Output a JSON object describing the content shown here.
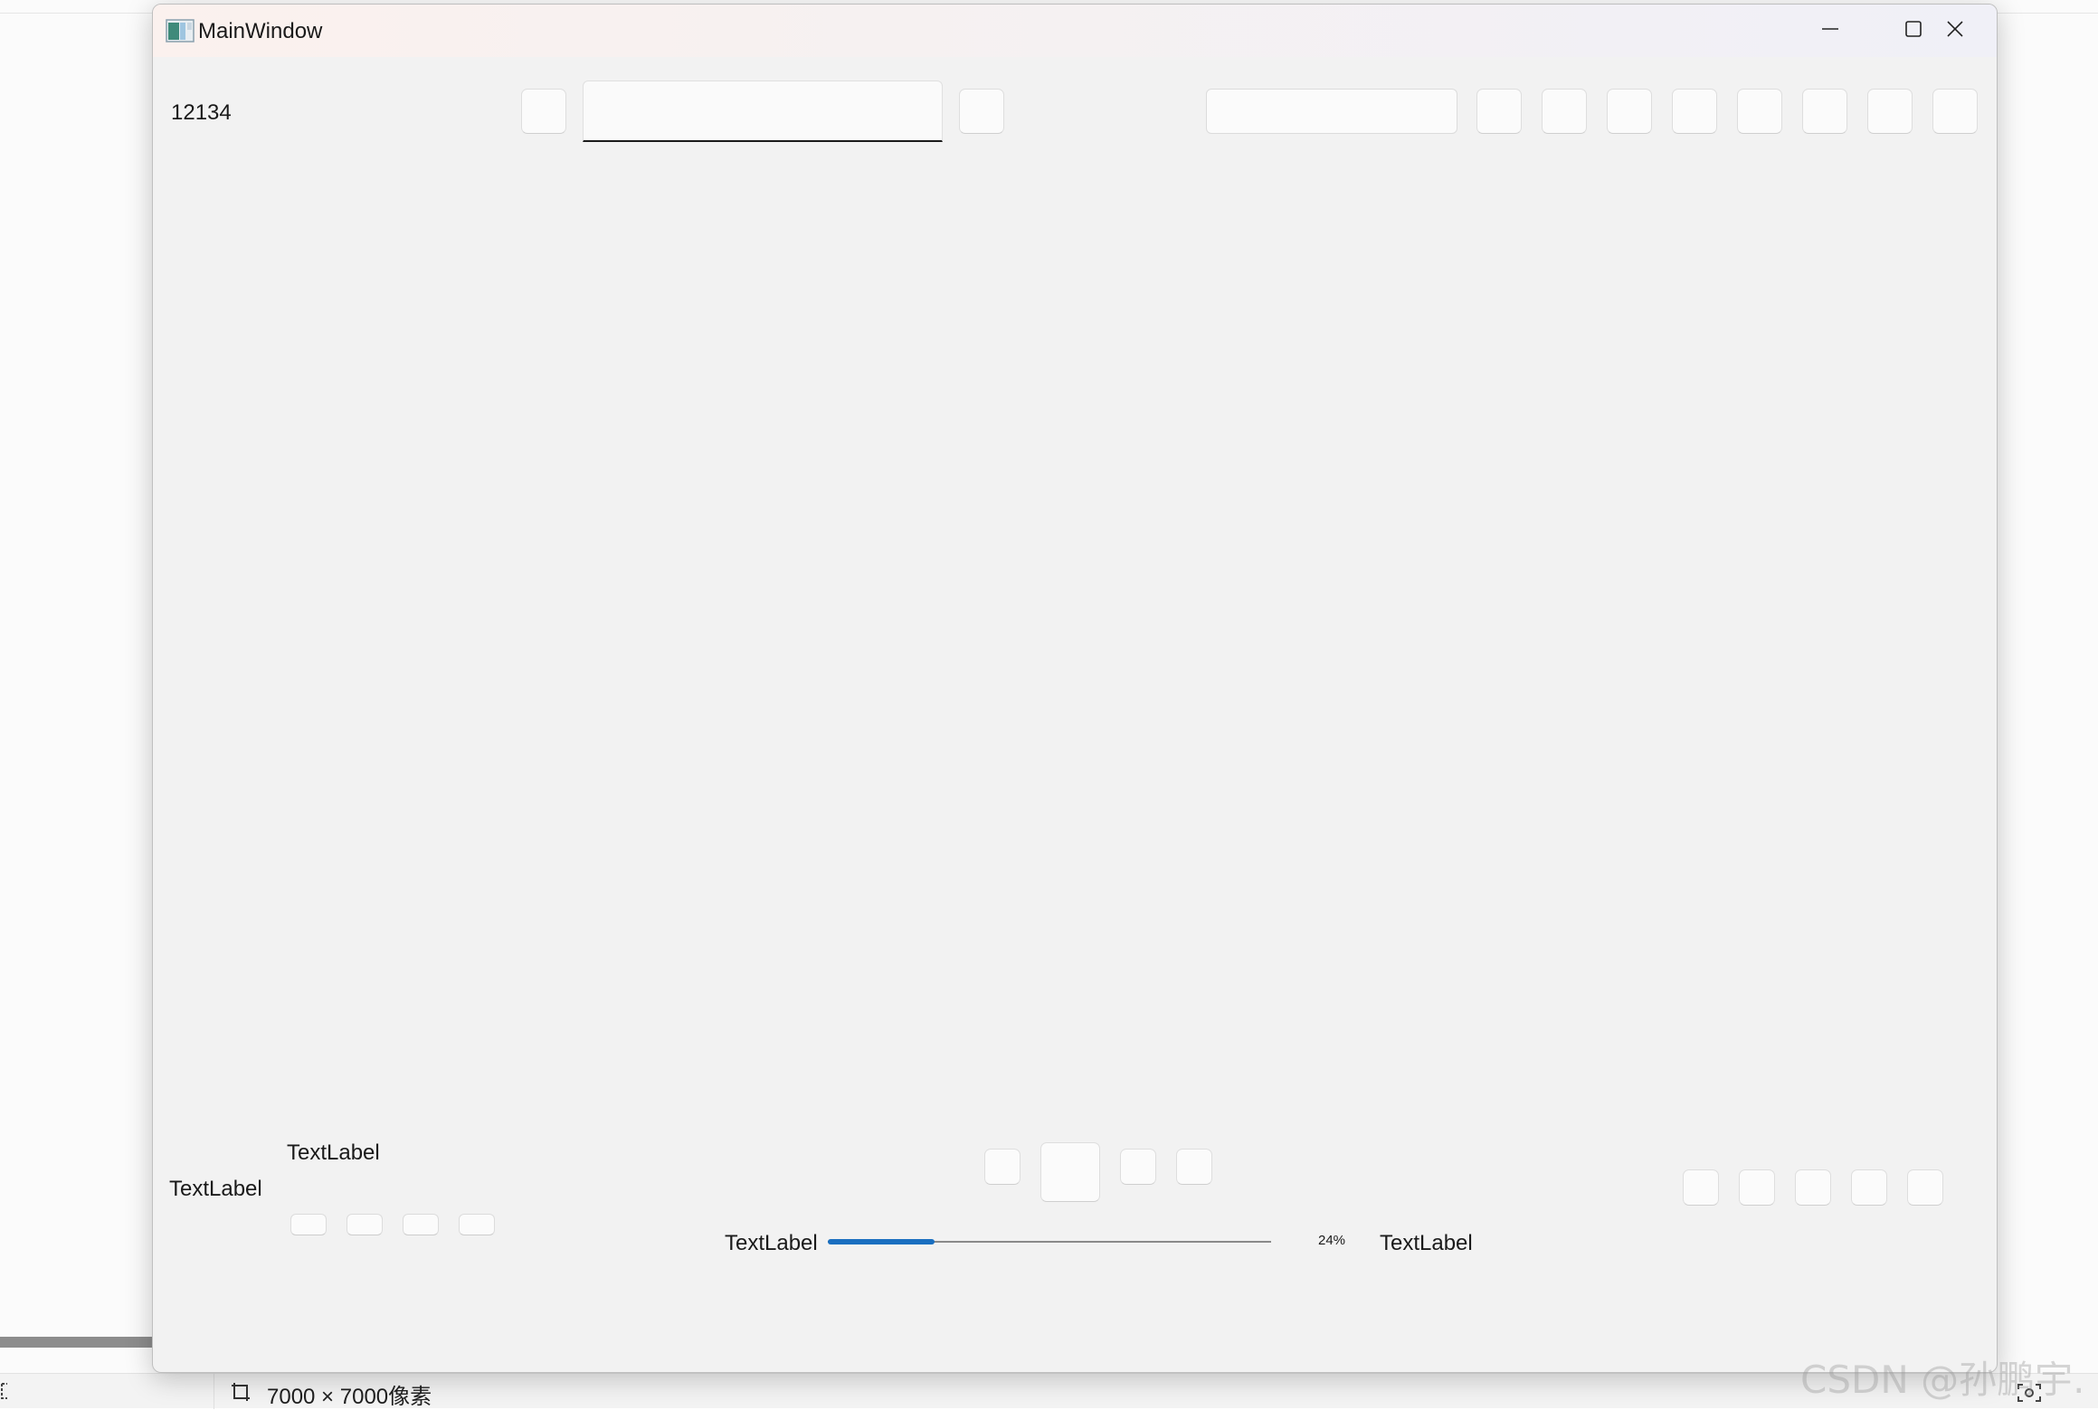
{
  "window": {
    "title": "MainWindow"
  },
  "toolbar": {
    "value_label": "12134",
    "line_edit_value": "",
    "combo_value": ""
  },
  "bottom": {
    "label_top": "TextLabel",
    "label_left": "TextLabel",
    "label_progress_left": "TextLabel",
    "label_progress_right": "TextLabel",
    "progress_text": "24%",
    "progress_value": 0.24
  },
  "statusbar": {
    "dimensions": "7000 × 7000像素"
  },
  "watermark": "CSDN @孙鹏宇.",
  "colors": {
    "accent": "#1a6fc0",
    "window_bg": "#f2f2f2"
  },
  "icons": {
    "app": "app-window-icon",
    "minimize": "minimize-icon",
    "maximize": "maximize-icon",
    "close": "close-icon",
    "dimensions": "crop-frame-icon"
  }
}
